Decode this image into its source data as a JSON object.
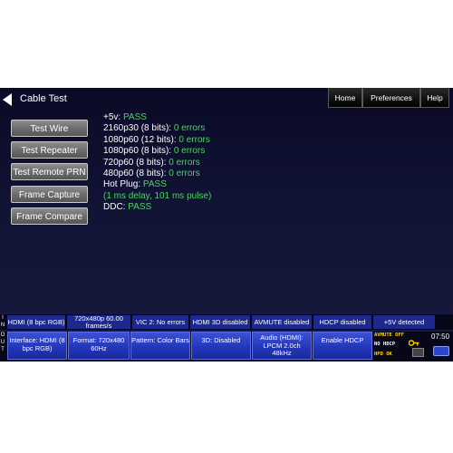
{
  "header": {
    "title": "Cable Test"
  },
  "tabs": [
    "Home",
    "Preferences",
    "Help"
  ],
  "menu": [
    "Test Wire",
    "Test Repeater",
    "Test Remote PRN",
    "Frame Capture",
    "Frame Compare"
  ],
  "results": [
    {
      "label": "+5v: ",
      "status": "PASS"
    },
    {
      "label": "2160p30 (8 bits): ",
      "status": "0 errors"
    },
    {
      "label": "1080p60 (12 bits): ",
      "status": "0 errors"
    },
    {
      "label": "1080p60 (8 bits): ",
      "status": "0 errors"
    },
    {
      "label": "720p60 (8 bits): ",
      "status": "0 errors"
    },
    {
      "label": "480p60 (8 bits): ",
      "status": "0 errors"
    },
    {
      "label": "Hot Plug: ",
      "status": "PASS"
    },
    {
      "label": "",
      "status": "(1 ms delay, 101 ms pulse)"
    },
    {
      "label": "DDC: ",
      "status": "PASS"
    }
  ],
  "status_side": [
    "I",
    "N"
  ],
  "status_bar": [
    "HDMI (8 bpc RGB)",
    "720x480p 60.00 frames/s",
    "VIC 2: No errors",
    "HDMI 3D disabled",
    "AVMUTE disabled",
    "HDCP disabled",
    "+5V detected"
  ],
  "controls_side": [
    "O",
    "U",
    "T"
  ],
  "controls": [
    "Interface: HDMI (8 bpc RGB)",
    "Format: 720x480 60Hz",
    "Pattern: Color Bars",
    "3D: Disabled",
    "Audio (HDMI): LPCM 2.0ch 48kHz",
    "Enable HDCP"
  ],
  "indicators": {
    "avmute": "AVMUTE OFF",
    "hdcp": "NO HDCP",
    "hpd": "HPD OK"
  },
  "clock": "07:50",
  "colors": {
    "pass": "#4cd460",
    "accent": "#2235b8",
    "status_cell": "#1d2a8c"
  }
}
